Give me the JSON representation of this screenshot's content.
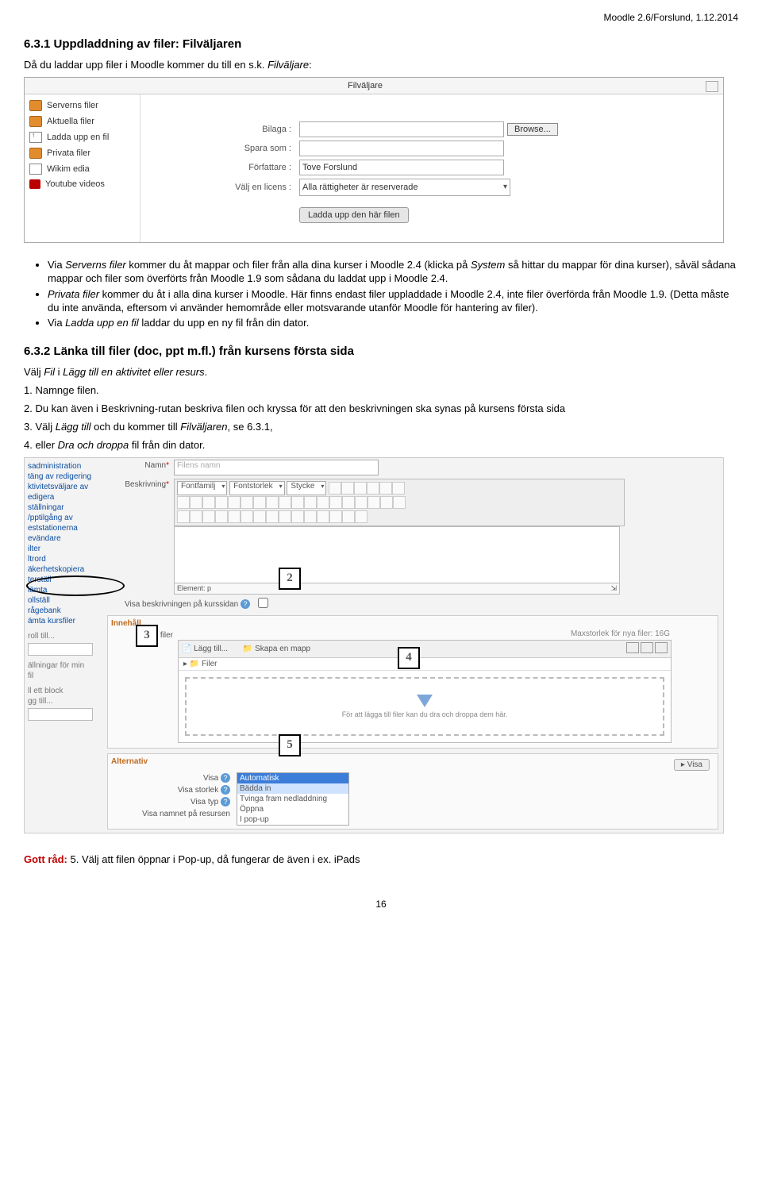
{
  "header": {
    "docref": "Moodle 2.6/Forslund, 1.12.2014"
  },
  "h1": "6.3.1 Uppdladdning av filer: Filväljaren",
  "intro": "Då du laddar upp filer i Moodle kommer du till en s.k. Filväljare:",
  "filvaljare": {
    "title": "Filväljare",
    "side": [
      "Serverns filer",
      "Aktuella filer",
      "Ladda upp en fil",
      "Privata filer",
      "Wikim edia",
      "Youtube videos"
    ],
    "rows": {
      "bilaga": "Bilaga :",
      "browse": "Browse...",
      "spara": "Spara som :",
      "forf": "Författare :",
      "forf_val": "Tove Forslund",
      "licens": "Välj en licens :",
      "licens_val": "Alla rättigheter är reserverade",
      "upload": "Ladda upp den här filen"
    }
  },
  "bullets1": [
    "Via Serverns filer kommer du åt mappar och filer från alla dina kurser i Moodle 2.4 (klicka på System så hittar du mappar för dina kurser), såväl sådana mappar och filer som överförts från Moodle 1.9 som sådana du laddat upp i Moodle 2.4.",
    "Privata filer kommer du åt i alla dina kurser i Moodle. Här finns endast filer uppladdade i Moodle 2.4, inte filer överförda från Moodle 1.9. (Detta måste du inte använda, eftersom vi använder hemområde eller motsvarande utanför Moodle för hantering av filer).",
    "Via Ladda upp en fil laddar du upp en ny fil från din dator."
  ],
  "h2": "6.3.2 Länka till filer (doc, ppt m.fl.) från kursens första sida",
  "p_valj": "Välj Fil i Lägg till en aktivitet eller resurs.",
  "steps": [
    "1. Namnge filen.",
    "2. Du kan även i Beskrivning-rutan beskriva filen och kryssa för att den beskrivningen ska synas på kursens första sida",
    "3. Välj Lägg till och du kommer till Filväljaren, se 6.3.1,",
    "4. eller Dra och droppa fil från din dator."
  ],
  "editor": {
    "sideLinks": [
      "sadministration",
      "täng av redigering",
      "ktivitetsväljare av",
      "edigera",
      "ställningar",
      "/pptilgång av",
      "eststationerna",
      "evändare",
      "ilter",
      "ltrord",
      "äkerhetskopiera",
      "terställ",
      "lämta",
      "ollställ",
      "rågebank",
      "ämta kursfiler"
    ],
    "sideGrey": [
      "roll till...",
      "ällningar för min",
      "fil",
      "ll ett block",
      "gg till..."
    ],
    "namn_lab": "Namn",
    "namn_ph": "Filens namn",
    "besk_lab": "Beskrivning",
    "tb_font": "Fontfamilj",
    "tb_size": "Fontstorlek",
    "tb_style": "Stycke",
    "status": "Element: p",
    "visa_kurs": "Visa beskrivningen på kurssidan",
    "innehall": "Innehåll",
    "valj_filer": "Välj filer",
    "maxsize": "Maxstorlek för nya filer: 16G",
    "lagg_till": "Lägg till...",
    "skapa": "Skapa en mapp",
    "filer": "Filer",
    "drop": "För att lägga till filer kan du dra och droppa dem här.",
    "alternativ": "Alternativ",
    "visa_btn": "Visa",
    "opt_labels": [
      "Visa",
      "Visa storlek",
      "Visa typ",
      "Visa namnet på resursen"
    ],
    "select_opts": [
      "Automatisk",
      "Bädda in",
      "Tvinga fram nedladdning",
      "Öppna",
      "I pop-up"
    ]
  },
  "anno": {
    "n2": "2",
    "n3": "3",
    "n4": "4",
    "n5": "5"
  },
  "gott_label": "Gott råd:",
  "gott_text": " 5. Välj att filen öppnar i Pop-up, då fungerar de även i ex. iPads",
  "pagenum": "16"
}
